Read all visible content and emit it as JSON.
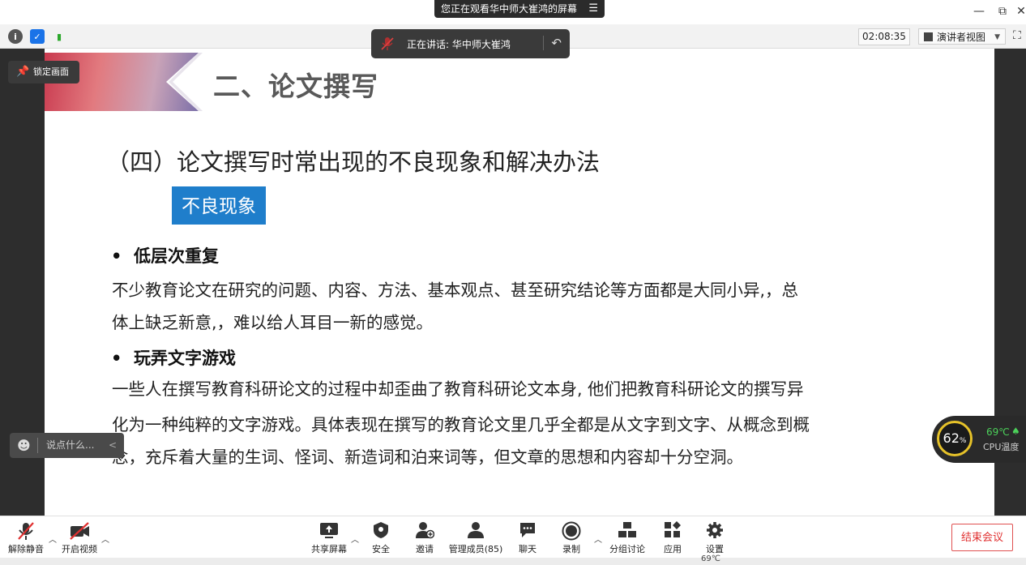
{
  "titlebar": {
    "banner_text": "您正在观看华中师大崔鸿的屏幕",
    "menu_icon": "menu-icon",
    "minimize": "—",
    "restore": "⧉",
    "close": "✕"
  },
  "toolbar": {
    "timer": "02:08:35",
    "view_label": "演讲者视图",
    "view_caret": "▼",
    "fullscreen_icon": "⛶"
  },
  "speaker": {
    "label": "正在讲话: 华中师大崔鸿"
  },
  "overlay": {
    "lock_label": "锁定画面",
    "chat_placeholder": "说点什么...",
    "chat_arrow": "<"
  },
  "slide": {
    "title": "二、论文撰写",
    "subtitle": "（四）论文撰写时常出现的不良现象和解决办法",
    "tag": "不良现象",
    "bullets": [
      {
        "dot": "•",
        "heading": "低层次重复",
        "lines": [
          "不少教育论文在研究的问题、内容、方法、基本观点、甚至研究结论等方面都是大同小异,，总",
          "体上缺乏新意,，难以给人耳目一新的感觉。"
        ]
      },
      {
        "dot": "•",
        "heading": "玩弄文字游戏",
        "lines": [
          "一些人在撰写教育科研论文的过程中却歪曲了教育科研论文本身, 他们把教育科研论文的撰写异",
          "化为一种纯粹的文字游戏。具体表现在撰写的教育论文里几乎全都是从文字到文字、从概念到概",
          "念，充斥着大量的生词、怪词、新造词和泊来词等，但文章的思想和内容却十分空洞。"
        ]
      }
    ]
  },
  "cpu": {
    "percent": "62",
    "percent_unit": "%",
    "temp": "69℃",
    "label": "CPU温度"
  },
  "bottom": {
    "unmute": "解除静音",
    "start_video": "开启视频",
    "share_screen": "共享屏幕",
    "security": "安全",
    "invite": "邀请",
    "manage_members": "管理成员(85)",
    "chat": "聊天",
    "record": "录制",
    "breakout": "分组讨论",
    "apps": "应用",
    "settings": "设置",
    "end_meeting": "结束会议"
  },
  "statusbar": {
    "temp": "69℃"
  },
  "colors": {
    "accent_blue": "#1f7ecb",
    "end_red": "#e03030",
    "cpu_ring": "#e6c229",
    "cpu_temp": "#4cd15a"
  }
}
